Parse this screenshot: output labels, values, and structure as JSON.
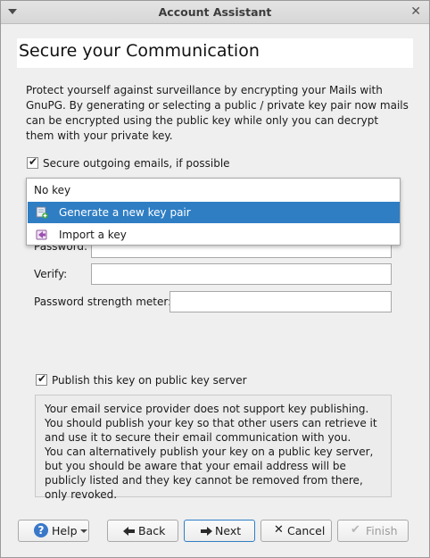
{
  "window": {
    "title": "Account Assistant"
  },
  "heading": "Secure your Communication",
  "intro": "Protect yourself against surveillance by encrypting your Mails with GnuPG. By generating or selecting a public / private key pair now mails can be encrypted using the public key while only you can decrypt them with your private key.",
  "secure_checkbox": {
    "label": "Secure outgoing emails, if possible",
    "checked": true
  },
  "key_dropdown": {
    "current": "No key",
    "options": [
      {
        "label": "Generate a new key pair",
        "icon": "key-add-icon",
        "selected": true
      },
      {
        "label": "Import a key",
        "icon": "key-import-icon",
        "selected": false
      }
    ]
  },
  "fields": {
    "password_label": "Password:",
    "verify_label": "Verify:",
    "strength_label": "Password strength meter:"
  },
  "publish_checkbox": {
    "label": "Publish this key on public key server",
    "checked": true
  },
  "notice": "Your email service provider does not support key publishing. You should publish your key so that other users can retrieve it and use it to secure their email communication with you.\nYou can alternatively publish your key on a public key server, but you should be aware that your email address will be publicly listed and they key cannot be removed from there, only revoked.",
  "buttons": {
    "help": "Help",
    "back": "Back",
    "next": "Next",
    "cancel": "Cancel",
    "finish": "Finish"
  },
  "colors": {
    "selection": "#2f7ec4",
    "help_icon": "#3a78c8"
  }
}
